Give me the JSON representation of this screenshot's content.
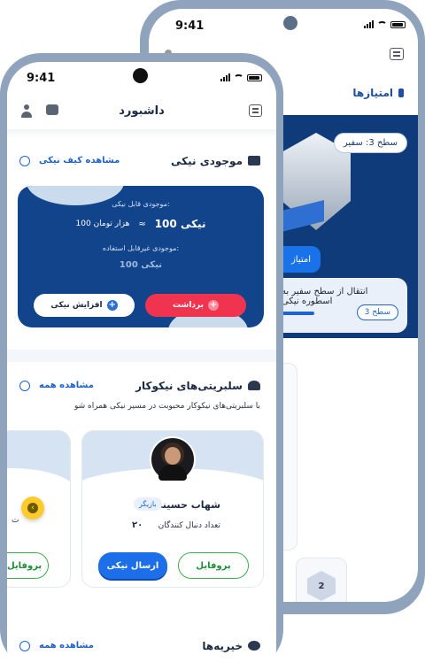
{
  "status_bar": {
    "time": "9:41"
  },
  "back_phone": {
    "time": "9:41",
    "header_title": "امتیازها",
    "level_pill": "سطح 3: سفیر",
    "points_button": "امتیاز",
    "progress_text": "انتقال از سطح سفیر به اسطوره نیکی",
    "progress_fraction": 0.45,
    "progress_level": "سطح 3",
    "badge_number": "2"
  },
  "header": {
    "title": "داشبورد"
  },
  "wallet": {
    "section_title": "موجودی نیکی",
    "view_link": "مشاهده کیف نیکی",
    "available_label": "موجودی قابل نیکی:",
    "available_amount": "100 نیکی",
    "approx_sign": "≈",
    "available_toman": "100 هزار تومان",
    "unused_label": "موجودی غیرقابل استفاده:",
    "unused_amount": "100 نیکی",
    "increase_button": "افزایش نیکی",
    "withdraw_button": "برداشت"
  },
  "celebrities": {
    "section_title": "سلبریتی‌های نیکوکار",
    "view_all": "مشاهده همه",
    "subtitle": "با سلبریتی‌های نیکوکار محبوبت در مسیر نیکی همراه شو",
    "cards": [
      {
        "name": "شهاب حسینی",
        "role": "بازیگر",
        "followers_label": "تعداد دنبال کنندگان",
        "followers_count": "۲۰",
        "send_button": "ارسال نیکی",
        "profile_button": "پروفایل"
      }
    ],
    "partial_card": {
      "profile_button": "پروفایل",
      "text_fragment": "ت"
    }
  },
  "charities": {
    "section_title": "خیریه‌ها",
    "view_all": "مشاهده همه"
  },
  "colors": {
    "primary_blue": "#11448a",
    "accent_blue": "#1c6fe8",
    "red": "#f0344f",
    "green": "#39b24a",
    "yellow": "#ffcb2b"
  }
}
